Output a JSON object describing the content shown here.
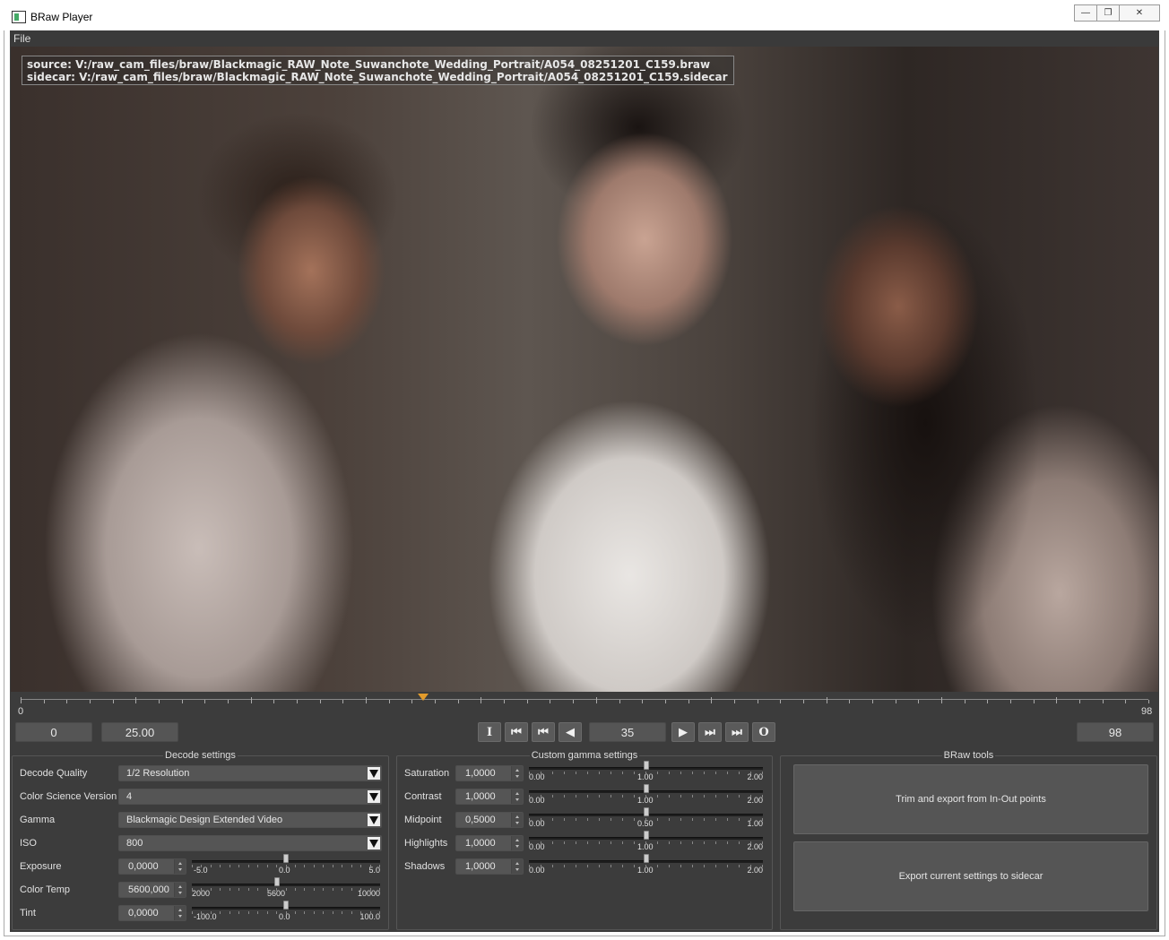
{
  "window": {
    "title": "BRaw Player",
    "minimize": "—",
    "maximize": "❐",
    "close": "✕"
  },
  "menu": {
    "file": "File"
  },
  "overlay": {
    "source": "source: V:/raw_cam_files/braw/Blackmagic_RAW_Note_Suwanchote_Wedding_Portrait/A054_08251201_C159.braw",
    "sidecar": "sidecar: V:/raw_cam_files/braw/Blackmagic_RAW_Note_Suwanchote_Wedding_Portrait/A054_08251201_C159.sidecar"
  },
  "timeline": {
    "min": "0",
    "max": "98",
    "current": 35
  },
  "transport": {
    "start_frame": "0",
    "fps": "25.00",
    "current_frame": "35",
    "end_frame": "98",
    "in_label": "I",
    "out_label": "O",
    "first_icon": "⏮",
    "prev_key_icon": "⏮",
    "back_icon": "◀",
    "play_icon": "▶",
    "next_key_icon": "⏭",
    "last_icon": "⏭"
  },
  "decode": {
    "title": "Decode settings",
    "quality_label": "Decode Quality",
    "quality_value": "1/2 Resolution",
    "css_label": "Color Science Version",
    "css_value": "4",
    "gamma_label": "Gamma",
    "gamma_value": "Blackmagic Design Extended Video",
    "iso_label": "ISO",
    "iso_value": "800",
    "exposure_label": "Exposure",
    "exposure_value": "0,0000",
    "exposure_min": "-5.0",
    "exposure_mid": "0.0",
    "exposure_max": "5.0",
    "colortemp_label": "Color Temp",
    "colortemp_value": "5600,000",
    "colortemp_min": "2000",
    "colortemp_mid": "5600",
    "colortemp_max": "10000",
    "tint_label": "Tint",
    "tint_value": "0,0000",
    "tint_min": "-100.0",
    "tint_mid": "0.0",
    "tint_max": "100.0"
  },
  "gamma": {
    "title": "Custom gamma settings",
    "saturation_label": "Saturation",
    "saturation_value": "1,0000",
    "saturation_min": "0.00",
    "saturation_mid": "1.00",
    "saturation_max": "2.00",
    "contrast_label": "Contrast",
    "contrast_value": "1,0000",
    "contrast_min": "0.00",
    "contrast_mid": "1.00",
    "contrast_max": "2.00",
    "midpoint_label": "Midpoint",
    "midpoint_value": "0,5000",
    "midpoint_min": "0.00",
    "midpoint_mid": "0.50",
    "midpoint_max": "1.00",
    "highlights_label": "Highlights",
    "highlights_value": "1,0000",
    "highlights_min": "0.00",
    "highlights_mid": "1.00",
    "highlights_max": "2.00",
    "shadows_label": "Shadows",
    "shadows_value": "1,0000",
    "shadows_min": "0.00",
    "shadows_mid": "1.00",
    "shadows_max": "2.00"
  },
  "tools": {
    "title": "BRaw tools",
    "trim_button": "Trim and export from In-Out points",
    "export_button": "Export current settings to sidecar"
  },
  "colors": {
    "accent": "#e39b2b",
    "panel_bg": "#3c3c3c",
    "field_bg": "#555555"
  }
}
